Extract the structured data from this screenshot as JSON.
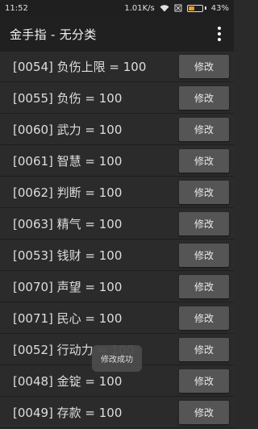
{
  "status_bar": {
    "time": "11:52",
    "net_speed": "1.01K/s",
    "battery_percent": "43%",
    "battery_level": 0.43,
    "icons": [
      "wifi-icon",
      "sim-blocked-icon",
      "battery-icon"
    ]
  },
  "app_bar": {
    "title": "金手指 - 无分类",
    "overflow_icon": "more-vert-icon"
  },
  "list": {
    "button_label": "修改",
    "items": [
      {
        "label": "[0054] 负伤上限 = 100"
      },
      {
        "label": "[0055] 负伤 = 100"
      },
      {
        "label": "[0060] 武力 = 100"
      },
      {
        "label": "[0061] 智慧 = 100"
      },
      {
        "label": "[0062] 判断 = 100"
      },
      {
        "label": "[0063] 精气 = 100"
      },
      {
        "label": "[0053] 钱财 = 100"
      },
      {
        "label": "[0070] 声望 = 100"
      },
      {
        "label": "[0071] 民心 = 100"
      },
      {
        "label": "[0052] 行动力 = 100"
      },
      {
        "label": "[0048] 金锭 = 100"
      },
      {
        "label": "[0049] 存款 = 100"
      }
    ]
  },
  "toast": {
    "message": "修改成功"
  },
  "colors": {
    "background": "#2a2a2a",
    "button": "#555555",
    "battery": "#f39c12"
  }
}
